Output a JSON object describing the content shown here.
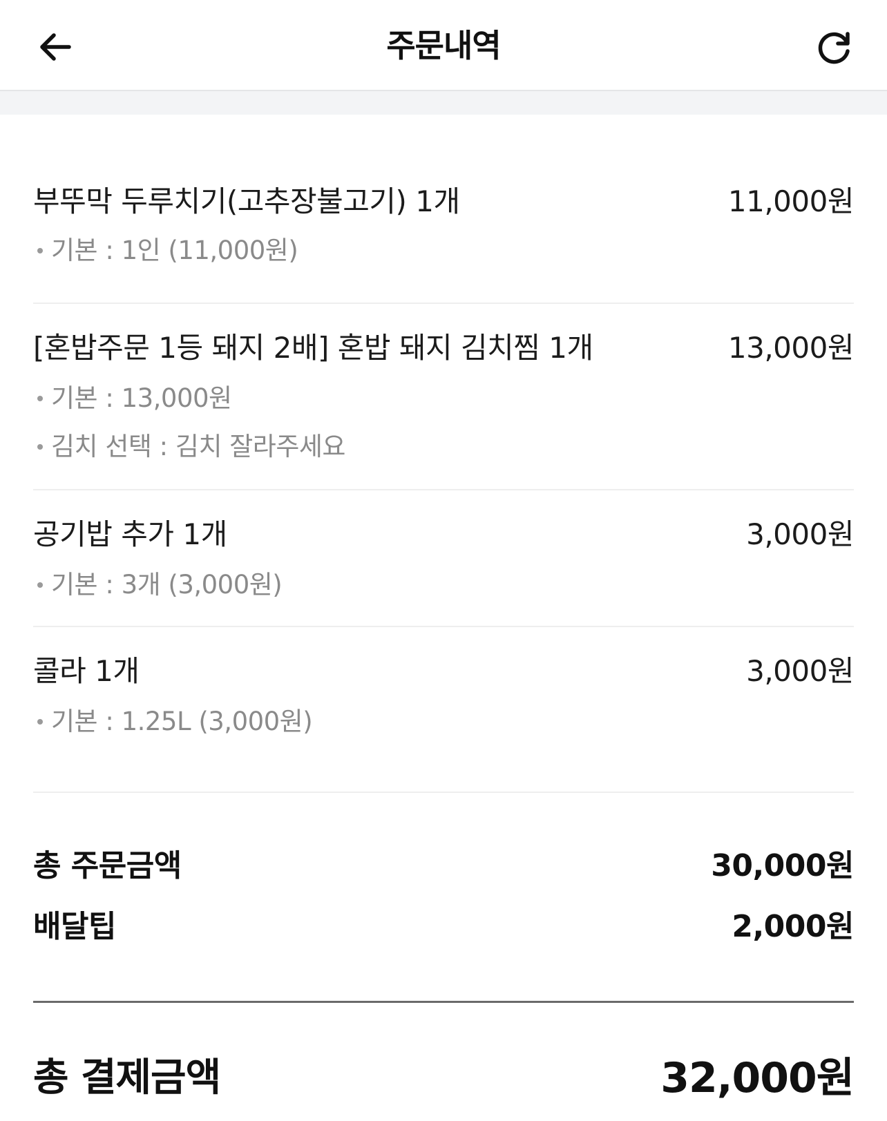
{
  "header": {
    "title": "주문내역",
    "back_icon": "arrow-left-icon",
    "refresh_icon": "refresh-icon"
  },
  "items": [
    {
      "name": "부뚜막 두루치기(고추장불고기) 1개",
      "price": "11,000원",
      "options": [
        "기본 : 1인 (11,000원)"
      ]
    },
    {
      "name": "[혼밥주문 1등 돼지 2배] 혼밥 돼지 김치찜 1개",
      "price": "13,000원",
      "options": [
        "기본 : 13,000원",
        "김치 선택 : 김치 잘라주세요"
      ]
    },
    {
      "name": "공기밥 추가 1개",
      "price": "3,000원",
      "options": [
        "기본 : 3개 (3,000원)"
      ]
    },
    {
      "name": "콜라 1개",
      "price": "3,000원",
      "options": [
        "기본 : 1.25L (3,000원)"
      ]
    }
  ],
  "summary": {
    "order_total_label": "총 주문금액",
    "order_total_value": "30,000원",
    "delivery_tip_label": "배달팁",
    "delivery_tip_value": "2,000원"
  },
  "payment": {
    "label": "총 결제금액",
    "value": "32,000원"
  }
}
